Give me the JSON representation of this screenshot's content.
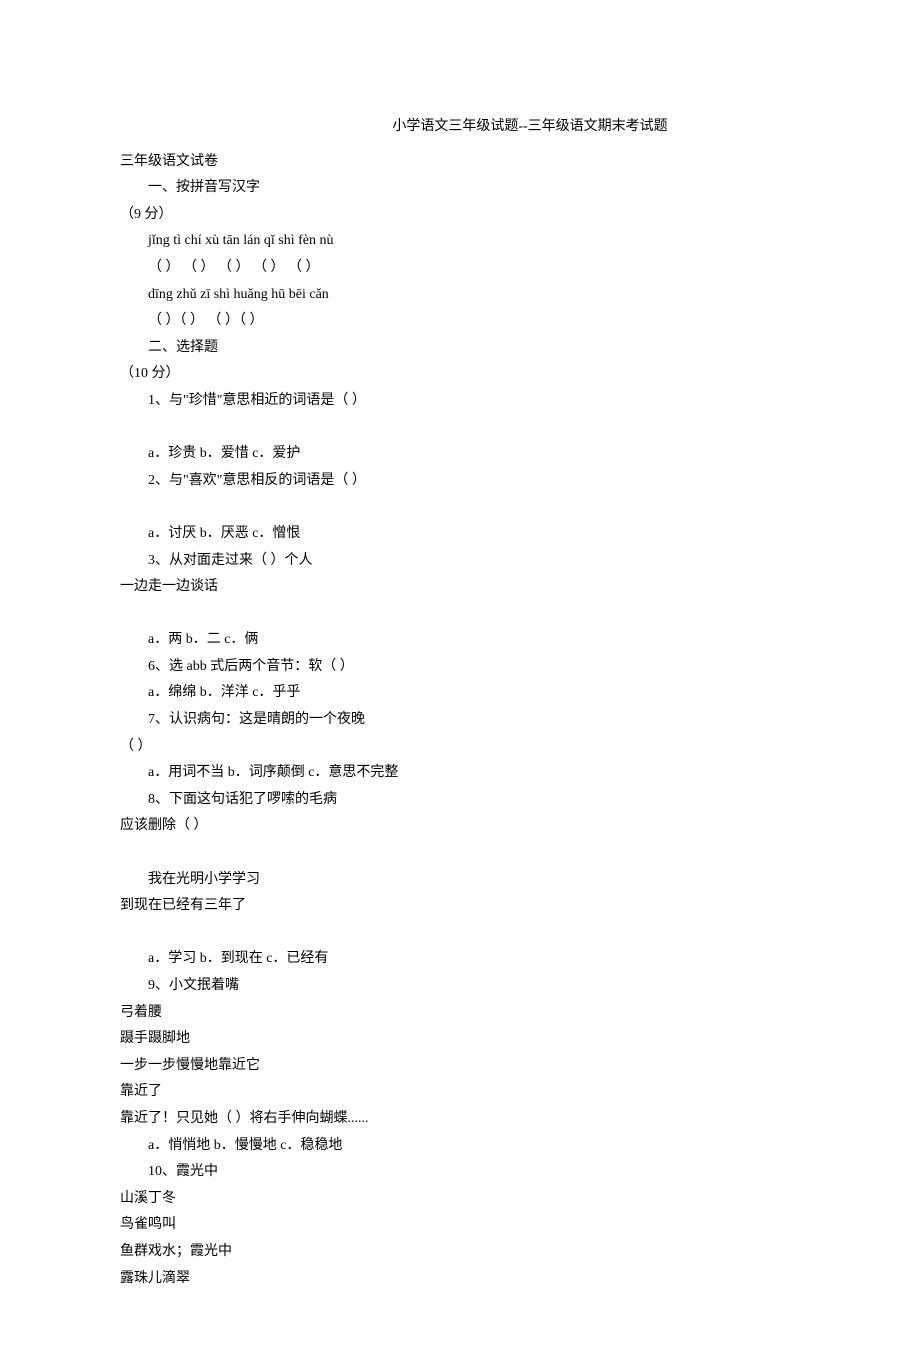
{
  "title": "小学语文三年级试题--三年级语文期末考试题",
  "subtitle": "三年级语文试卷",
  "section1": {
    "heading": "一、按拼音写汉字",
    "points": "（9 分）",
    "row1_pinyin": "jǐng  tì   chí  xù    tān  lán    qǐ  shì    fèn  nù",
    "row1_blanks": "（      ） （      ） （      ） （      ） （      ）",
    "row2_pinyin": "dīng zhǔ  zī   shì    huǎng  hū   bēi  cǎn",
    "row2_blanks": "（     ）（      ） （        ）（       ）"
  },
  "section2": {
    "heading": "二、选择题",
    "points": "（10 分）",
    "q1": "1、与\"珍惜\"意思相近的词语是（ ）",
    "q1_opts": "a．珍贵 b．爱惜 c．爱护",
    "q2": "2、与\"喜欢\"意思相反的词语是（ ）",
    "q2_opts": "a．讨厌 b．厌恶 c．憎恨",
    "q3": "3、从对面走过来（ ）个人",
    "q3_tail": "一边走一边谈话",
    "q3_opts": "a．两 b．二 c．俩",
    "q6": "6、选 abb 式后两个音节：软（ ）",
    "q6_opts": "a．绵绵 b．洋洋 c．乎乎",
    "q7": "7、认识病句：这是晴朗的一个夜晚",
    "q7_tail": "（ ）",
    "q7_opts": "a．用词不当 b．词序颠倒 c．意思不完整",
    "q8": "8、下面这句话犯了啰嗦的毛病",
    "q8_tail": "应该删除（ ）",
    "q8_line1": "我在光明小学学习",
    "q8_line2": "到现在已经有三年了",
    "q8_opts": "a．学习 b．到现在 c．已经有",
    "q9": "9、小文抿着嘴",
    "q9_l2": "弓着腰",
    "q9_l3": "蹑手蹑脚地",
    "q9_l4": "一步一步慢慢地靠近它",
    "q9_l5": "靠近了",
    "q9_l6": "靠近了！只见她（ ）将右手伸向蝴蝶......",
    "q9_opts": "a．悄悄地 b．慢慢地 c．稳稳地",
    "q10": "10、霞光中",
    "q10_l2": "山溪丁冬",
    "q10_l3": "鸟雀鸣叫",
    "q10_l4": "鱼群戏水；霞光中",
    "q10_l5": "露珠儿滴翠"
  }
}
